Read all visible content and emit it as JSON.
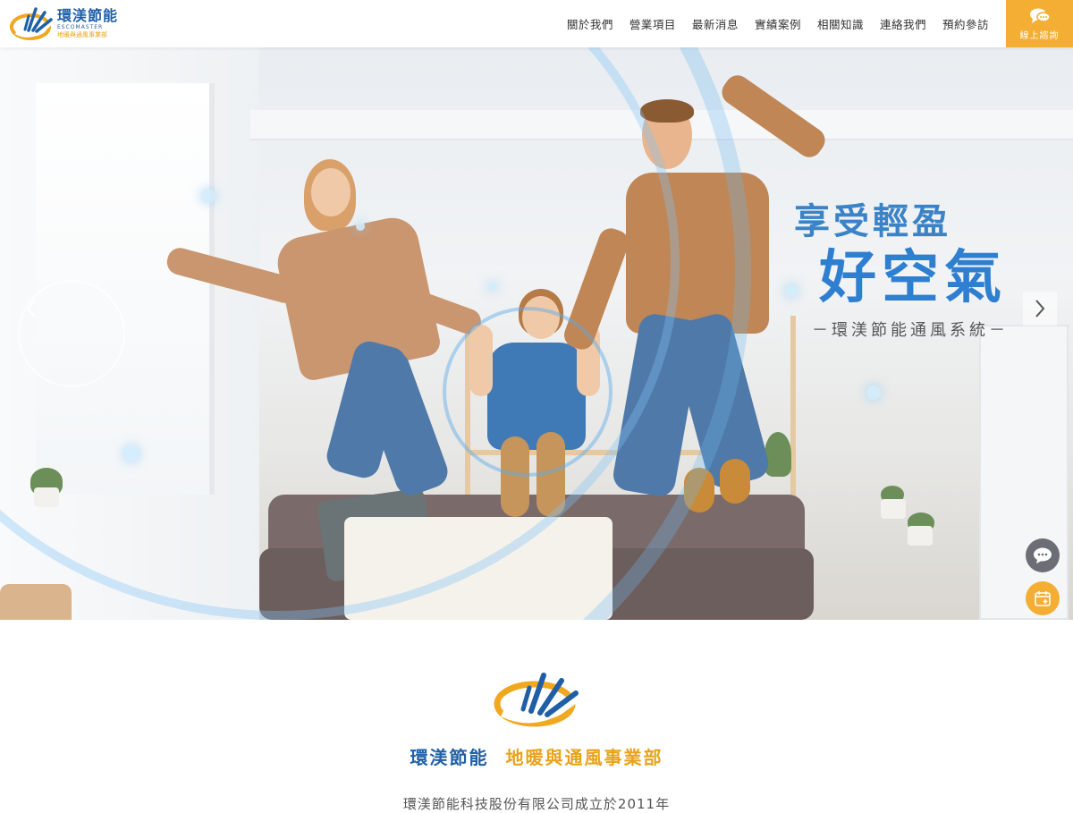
{
  "header": {
    "logo_cn": "環渼節能",
    "logo_en": "ESCOMASTER",
    "logo_sub": "地暖與通風事業部",
    "nav": [
      "關於我們",
      "營業項目",
      "最新消息",
      "實績案例",
      "相關知識",
      "連絡我們",
      "預約參訪"
    ],
    "consult_label": "線上諮詢",
    "consult_icon": "chat-bubbles-icon",
    "accent_color": "#f4ae33",
    "brand_color": "#1f5fa8"
  },
  "hero": {
    "slogan_line1": "享受輕盈",
    "slogan_line2": "好空氣",
    "slogan_line3": "－環渼節能通風系統－",
    "prev_icon": "chevron-left-icon",
    "next_icon": "chevron-right-icon"
  },
  "floating": {
    "chat_icon": "chat-icon",
    "calendar_icon": "calendar-add-icon"
  },
  "intro": {
    "title_blue": "環渼節能",
    "title_gold": "地暖與通風事業部",
    "description": "環渼節能科技股份有限公司成立於2011年"
  }
}
